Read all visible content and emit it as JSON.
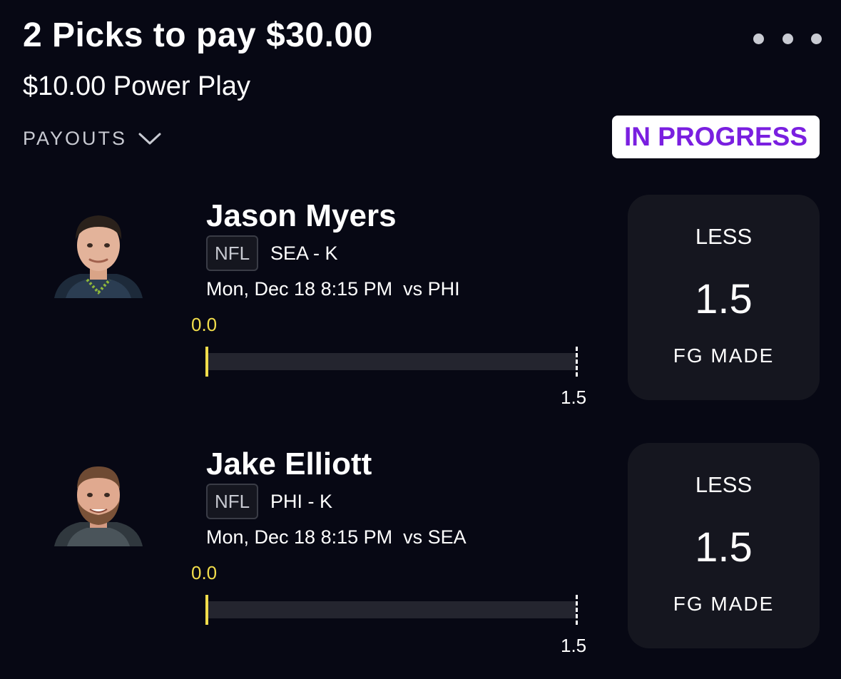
{
  "header": {
    "title": "2 Picks to pay $30.00",
    "subtitle": "$10.00 Power Play",
    "payouts_label": "PAYOUTS",
    "status": "IN PROGRESS",
    "more_icon": "more-horizontal-icon",
    "payouts_icon": "chevron-down-icon"
  },
  "colors": {
    "background": "#070814",
    "status_text": "#7a1fe0",
    "progress_value": "#f1dd4b",
    "card_background": "#15161f"
  },
  "picks": [
    {
      "player": "Jason Myers",
      "league": "NFL",
      "team_position": "SEA - K",
      "game": "Mon, Dec 18 8:15 PM  vs PHI",
      "current": "0.0",
      "target": "1.5",
      "progress_fraction": 0,
      "direction": "LESS",
      "line": "1.5",
      "stat": "FG MADE"
    },
    {
      "player": "Jake Elliott",
      "league": "NFL",
      "team_position": "PHI - K",
      "game": "Mon, Dec 18 8:15 PM  vs SEA",
      "current": "0.0",
      "target": "1.5",
      "progress_fraction": 0,
      "direction": "LESS",
      "line": "1.5",
      "stat": "FG MADE"
    }
  ]
}
